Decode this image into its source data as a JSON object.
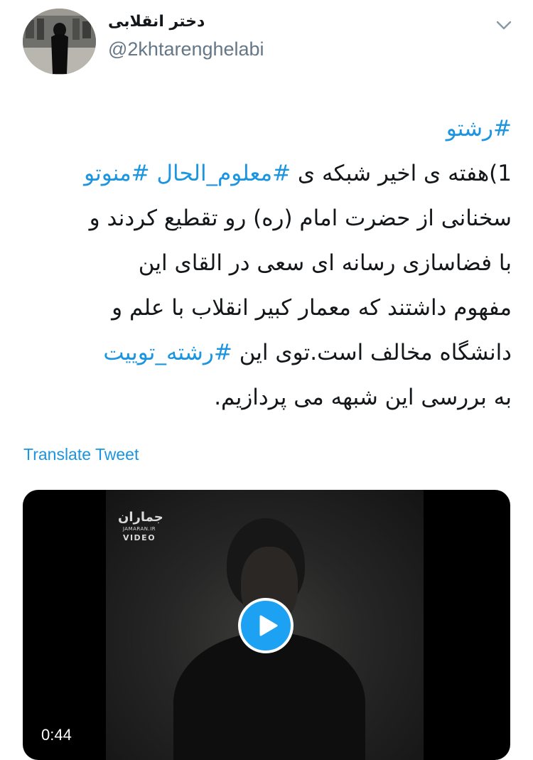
{
  "user": {
    "display_name": "دختر انقلابی",
    "handle": "@2khtarenghelabi"
  },
  "icons": {
    "menu": "chevron-down-icon",
    "play": "play-icon"
  },
  "tweet": {
    "lines": [
      [
        {
          "text": "#رشتو",
          "tag": true
        }
      ],
      [
        {
          "text": "1)هفته ی اخیر شبکه ی ",
          "tag": false
        },
        {
          "text": "#معلوم_الحال",
          "tag": true
        },
        {
          "text": " ",
          "tag": false
        },
        {
          "text": "#منوتو",
          "tag": true
        }
      ],
      [
        {
          "text": "سخنانی از حضرت امام (ره) رو تقطیع کردند و",
          "tag": false
        }
      ],
      [
        {
          "text": "با فضاسازی رسانه ای سعی در القای این",
          "tag": false
        }
      ],
      [
        {
          "text": "مفهوم داشتند که معمار کبیر انقلاب با علم و",
          "tag": false
        }
      ],
      [
        {
          "text": "دانشگاه مخالف است.توی این ",
          "tag": false
        },
        {
          "text": "#رشته_توییت",
          "tag": true
        }
      ],
      [
        {
          "text": "به بررسی این شبهه می پردازیم.",
          "tag": false
        }
      ]
    ],
    "translate_label": "Translate Tweet"
  },
  "media": {
    "watermark_logo": "جماران",
    "watermark_sub": "JAMARAN.IR",
    "watermark_video": "VIDEO",
    "duration": "0:44"
  },
  "colors": {
    "link": "#1b95e0",
    "play_button": "#1da1f2",
    "secondary_text": "#657786"
  }
}
